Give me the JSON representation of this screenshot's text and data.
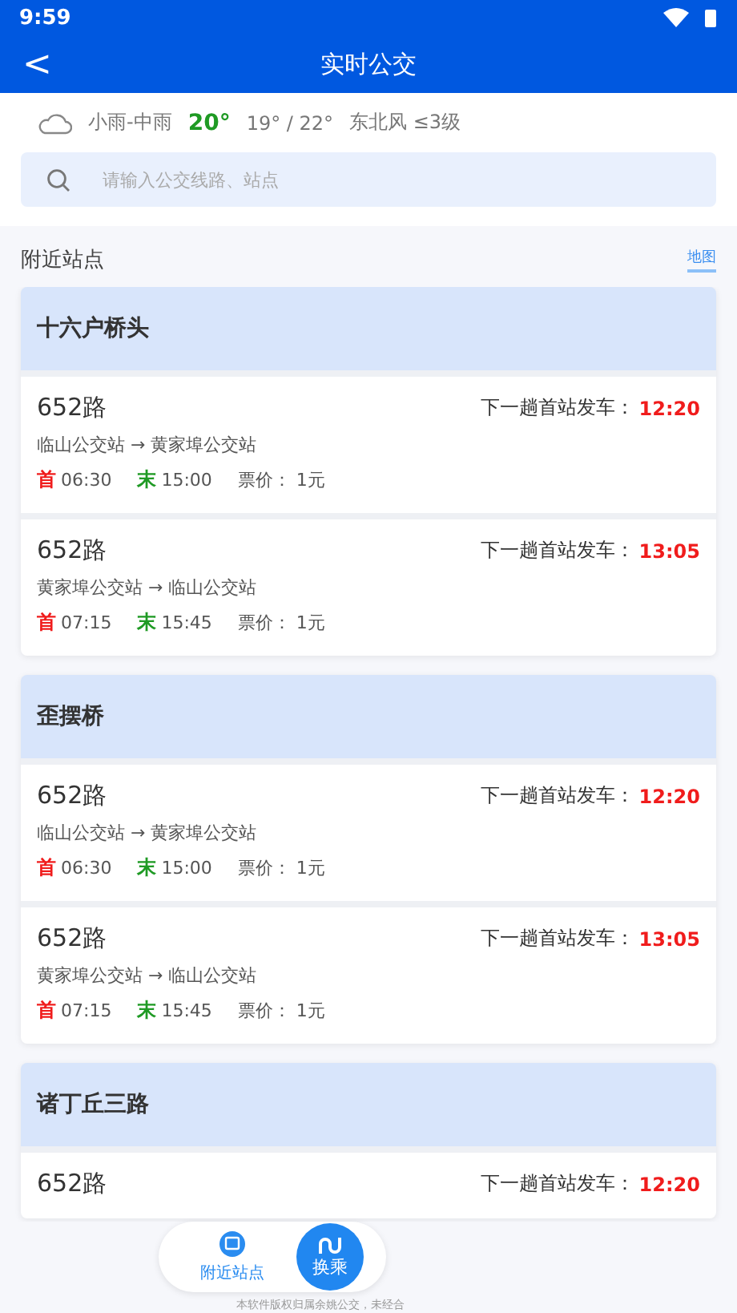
{
  "status_bar": {
    "time": "9:59"
  },
  "header": {
    "back": "<",
    "title": "实时公交"
  },
  "weather": {
    "condition": "小雨-中雨",
    "temp": "20°",
    "range": "19° / 22°",
    "wind": "东北风 ≤3级"
  },
  "search": {
    "placeholder": "请输入公交线路、站点"
  },
  "section": {
    "title": "附近站点",
    "link": "地图"
  },
  "stations": [
    {
      "name": "十六户桥头",
      "routes": [
        {
          "name": "652路",
          "next_label": "下一趟首站发车：",
          "next_time": "12:20",
          "direction": "临山公交站 → 黄家埠公交站",
          "first_label": "首",
          "first": "06:30",
          "last_label": "末",
          "last": "15:00",
          "fare": "票价：  1元"
        },
        {
          "name": "652路",
          "next_label": "下一趟首站发车：",
          "next_time": "13:05",
          "direction": "黄家埠公交站 → 临山公交站",
          "first_label": "首",
          "first": "07:15",
          "last_label": "末",
          "last": "15:45",
          "fare": "票价：  1元"
        }
      ]
    },
    {
      "name": "歪摆桥",
      "routes": [
        {
          "name": "652路",
          "next_label": "下一趟首站发车：",
          "next_time": "12:20",
          "direction": "临山公交站 → 黄家埠公交站",
          "first_label": "首",
          "first": "06:30",
          "last_label": "末",
          "last": "15:00",
          "fare": "票价：  1元"
        },
        {
          "name": "652路",
          "next_label": "下一趟首站发车：",
          "next_time": "13:05",
          "direction": "黄家埠公交站 → 临山公交站",
          "first_label": "首",
          "first": "07:15",
          "last_label": "末",
          "last": "15:45",
          "fare": "票价：  1元"
        }
      ]
    },
    {
      "name": "诸丁丘三路",
      "routes": [
        {
          "name": "652路",
          "next_label": "下一趟首站发车：",
          "next_time": "12:20"
        }
      ]
    }
  ],
  "bottom_nav": [
    {
      "label": "附近站点",
      "kind": "tab",
      "selected": true
    },
    {
      "label": "换乘",
      "kind": "fab",
      "selected": false
    }
  ],
  "footer": "本软件版权归属余姚公交，未经合"
}
